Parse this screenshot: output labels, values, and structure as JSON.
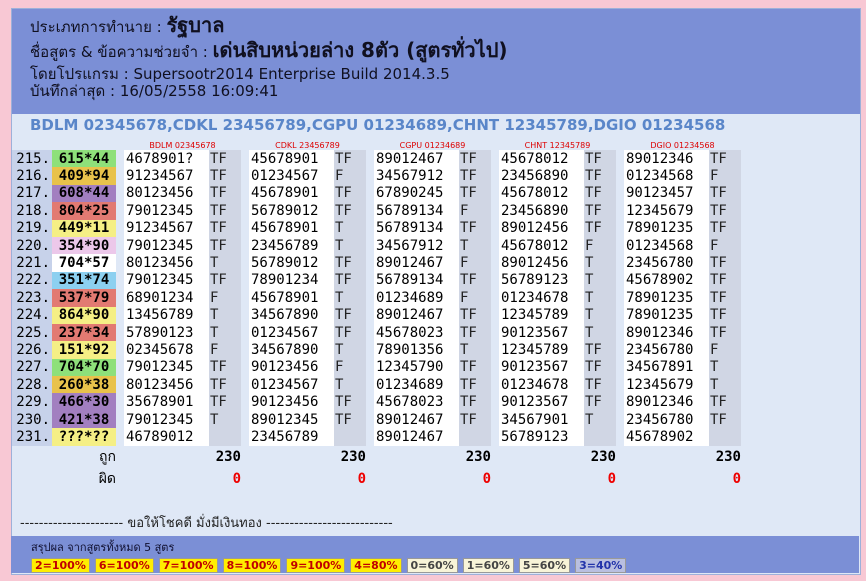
{
  "header": {
    "type_label": "ประเภทการทำนาย :",
    "type_value": "รัฐบาล",
    "name_label": "ชื่อสูตร & ข้อความช่วยจำ :",
    "name_value": "เด่นสิบหน่วยล่าง 8ตัว (สูตรทั่วไป)",
    "program_line": "โดยโปรแกรม : Supersootr2014 Enterprise Build 2014.3.5",
    "saved_line": "บันทึกล่าสุด : 16/05/2558 16:09:41"
  },
  "formulas_line": "BDLM 02345678,CDKL 23456789,CGPU 01234689,CHNT 12345789,DGIO 01234568",
  "col_heads": [
    "BDLM 02345678",
    "CDKL 23456789",
    "CGPU 01234689",
    "CHNT 12345789",
    "DGIO 01234568"
  ],
  "rows": [
    {
      "no": "215.",
      "pred": "615*44",
      "bg": "#8ee07a",
      "cells": [
        [
          "4678901?",
          "TF"
        ],
        [
          "45678901",
          "TF"
        ],
        [
          "89012467",
          "TF"
        ],
        [
          "45678012",
          "TF"
        ],
        [
          "89012346",
          "TF"
        ]
      ]
    },
    {
      "no": "216.",
      "pred": "409*94",
      "bg": "#e8c24b",
      "cells": [
        [
          "91234567",
          "TF"
        ],
        [
          "01234567",
          "F"
        ],
        [
          "34567912",
          "TF"
        ],
        [
          "23456890",
          "TF"
        ],
        [
          "01234568",
          "F"
        ]
      ]
    },
    {
      "no": "217.",
      "pred": "608*44",
      "bg": "#a27fc0",
      "cells": [
        [
          "80123456",
          "TF"
        ],
        [
          "45678901",
          "TF"
        ],
        [
          "67890245",
          "TF"
        ],
        [
          "45678012",
          "TF"
        ],
        [
          "90123457",
          "TF"
        ]
      ]
    },
    {
      "no": "218.",
      "pred": "804*25",
      "bg": "#e27a72",
      "cells": [
        [
          "79012345",
          "TF"
        ],
        [
          "56789012",
          "TF"
        ],
        [
          "56789134",
          "F"
        ],
        [
          "23456890",
          "TF"
        ],
        [
          "12345679",
          "TF"
        ]
      ]
    },
    {
      "no": "219.",
      "pred": "449*11",
      "bg": "#f5ef85",
      "cells": [
        [
          "91234567",
          "TF"
        ],
        [
          "45678901",
          "T"
        ],
        [
          "56789134",
          "TF"
        ],
        [
          "89012456",
          "TF"
        ],
        [
          "78901235",
          "TF"
        ]
      ]
    },
    {
      "no": "220.",
      "pred": "354*90",
      "bg": "#ecc8ea",
      "cells": [
        [
          "79012345",
          "TF"
        ],
        [
          "23456789",
          "T"
        ],
        [
          "34567912",
          "T"
        ],
        [
          "45678012",
          "F"
        ],
        [
          "01234568",
          "F"
        ]
      ]
    },
    {
      "no": "221.",
      "pred": "704*57",
      "bg": "#ffffff",
      "cells": [
        [
          "80123456",
          "T"
        ],
        [
          "56789012",
          "TF"
        ],
        [
          "89012467",
          "F"
        ],
        [
          "89012456",
          "T"
        ],
        [
          "23456780",
          "TF"
        ]
      ]
    },
    {
      "no": "222.",
      "pred": "351*74",
      "bg": "#8cd0f0",
      "cells": [
        [
          "79012345",
          "TF"
        ],
        [
          "78901234",
          "TF"
        ],
        [
          "56789134",
          "TF"
        ],
        [
          "56789123",
          "T"
        ],
        [
          "45678902",
          "TF"
        ]
      ]
    },
    {
      "no": "223.",
      "pred": "537*79",
      "bg": "#e27a72",
      "cells": [
        [
          "68901234",
          "F"
        ],
        [
          "45678901",
          "T"
        ],
        [
          "01234689",
          "F"
        ],
        [
          "01234678",
          "T"
        ],
        [
          "78901235",
          "TF"
        ]
      ]
    },
    {
      "no": "224.",
      "pred": "864*90",
      "bg": "#f5ef85",
      "cells": [
        [
          "13456789",
          "T"
        ],
        [
          "34567890",
          "TF"
        ],
        [
          "89012467",
          "TF"
        ],
        [
          "12345789",
          "T"
        ],
        [
          "78901235",
          "TF"
        ]
      ]
    },
    {
      "no": "225.",
      "pred": "237*34",
      "bg": "#e27a72",
      "cells": [
        [
          "57890123",
          "T"
        ],
        [
          "01234567",
          "TF"
        ],
        [
          "45678023",
          "TF"
        ],
        [
          "90123567",
          "T"
        ],
        [
          "89012346",
          "TF"
        ]
      ]
    },
    {
      "no": "226.",
      "pred": "151*92",
      "bg": "#f5ef85",
      "cells": [
        [
          "02345678",
          "F"
        ],
        [
          "34567890",
          "T"
        ],
        [
          "78901356",
          "T"
        ],
        [
          "12345789",
          "TF"
        ],
        [
          "23456780",
          "F"
        ]
      ]
    },
    {
      "no": "227.",
      "pred": "704*70",
      "bg": "#8ee07a",
      "cells": [
        [
          "79012345",
          "TF"
        ],
        [
          "90123456",
          "F"
        ],
        [
          "12345790",
          "TF"
        ],
        [
          "90123567",
          "TF"
        ],
        [
          "34567891",
          "T"
        ]
      ]
    },
    {
      "no": "228.",
      "pred": "260*38",
      "bg": "#e8c24b",
      "cells": [
        [
          "80123456",
          "TF"
        ],
        [
          "01234567",
          "T"
        ],
        [
          "01234689",
          "TF"
        ],
        [
          "01234678",
          "TF"
        ],
        [
          "12345679",
          "T"
        ]
      ]
    },
    {
      "no": "229.",
      "pred": "466*30",
      "bg": "#a27fc0",
      "cells": [
        [
          "35678901",
          "TF"
        ],
        [
          "90123456",
          "TF"
        ],
        [
          "45678023",
          "TF"
        ],
        [
          "90123567",
          "TF"
        ],
        [
          "89012346",
          "TF"
        ]
      ]
    },
    {
      "no": "230.",
      "pred": "421*38",
      "bg": "#a27fc0",
      "cells": [
        [
          "79012345",
          "T"
        ],
        [
          "89012345",
          "TF"
        ],
        [
          "89012467",
          "TF"
        ],
        [
          "34567901",
          "T"
        ],
        [
          "23456780",
          "TF"
        ]
      ]
    },
    {
      "no": "231.",
      "pred": "???*??",
      "bg": "#f5ef85",
      "cells": [
        [
          "46789012",
          ""
        ],
        [
          "23456789",
          ""
        ],
        [
          "89012467",
          ""
        ],
        [
          "56789123",
          ""
        ],
        [
          "45678902",
          ""
        ]
      ]
    }
  ],
  "stats": {
    "hit_label": "ถูก",
    "miss_label": "ผิด",
    "hits": [
      "230",
      "230",
      "230",
      "230",
      "230"
    ],
    "misses": [
      "0",
      "0",
      "0",
      "0",
      "0"
    ]
  },
  "footer_text": "---------------------- ขอให้โชคดี มั่งมีเงินทอง ---------------------------",
  "summary": {
    "title": "สรุปผล จากสูตรทั้งหมด 5 สูตร",
    "badges": [
      {
        "text": "2=100%",
        "bg": "#ffee00",
        "color": "#c00000"
      },
      {
        "text": "6=100%",
        "bg": "#ffee00",
        "color": "#c00000"
      },
      {
        "text": "7=100%",
        "bg": "#ffee00",
        "color": "#c00000"
      },
      {
        "text": "8=100%",
        "bg": "#ffee00",
        "color": "#c00000"
      },
      {
        "text": "9=100%",
        "bg": "#ffee00",
        "color": "#c00000"
      },
      {
        "text": "4=80%",
        "bg": "#ffee00",
        "color": "#c00000"
      },
      {
        "text": "0=60%",
        "bg": "#f8f4d8",
        "color": "#444"
      },
      {
        "text": "1=60%",
        "bg": "#f8f4d8",
        "color": "#444"
      },
      {
        "text": "5=60%",
        "bg": "#f8f4d8",
        "color": "#444"
      },
      {
        "text": "3=40%",
        "bg": "#b9bfe0",
        "color": "#2233aa"
      }
    ]
  }
}
